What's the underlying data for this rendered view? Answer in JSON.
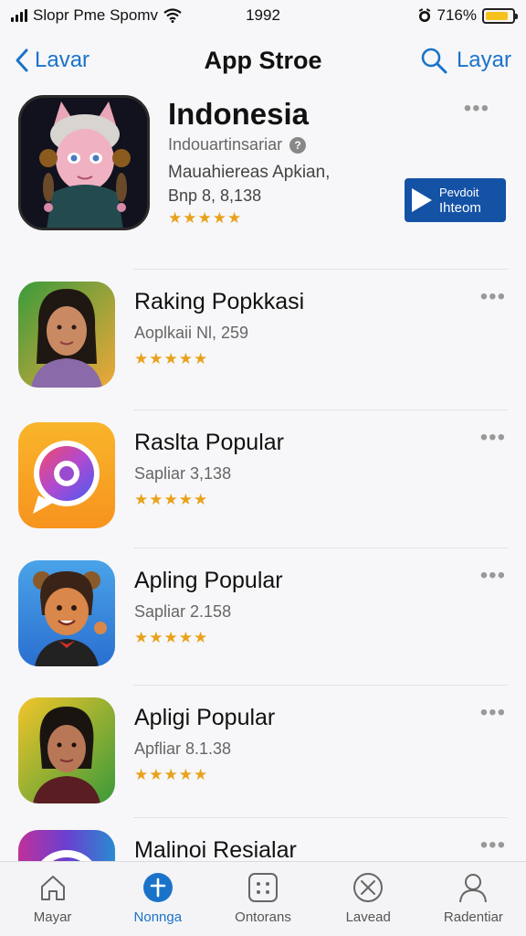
{
  "status_bar": {
    "carrier": "Slopr Pme Spomv",
    "time": "1992",
    "battery": "716%",
    "battery_level": 0.85,
    "battery_color": "#f4c21b"
  },
  "nav": {
    "back_label": "Lavar",
    "title": "App Stroe",
    "search_label": "Layar",
    "accent_color": "#1a73c9"
  },
  "featured": {
    "title": "Indonesia",
    "subtitle": "Indouartinsariar",
    "description": "Mauahiereas Apkian,",
    "count": "Bnp 8, 8,138",
    "rating": 4.5,
    "get_button": {
      "line1": "Pevdoit",
      "line2": "Ihteom",
      "color": "#1452a6"
    }
  },
  "apps": [
    {
      "name": "Raking Popkkasi",
      "meta": "Aoplkaii Nl, 259",
      "rating": 4.5,
      "icon": "avatar-woman-icon"
    },
    {
      "name": "Raslta Popular",
      "meta": "Sapliar 3,138",
      "rating": 4.5,
      "icon": "chat-bubble-icon"
    },
    {
      "name": "Apling Popular",
      "meta": "Sapliar 2.158",
      "rating": 4.5,
      "icon": "avatar-bear-icon"
    },
    {
      "name": "Apligi Popular",
      "meta": "Apfliar 8.1.38",
      "rating": 4.5,
      "icon": "avatar-woman-icon"
    },
    {
      "name": "Malinoi Resialar",
      "meta": "",
      "rating": 0,
      "icon": "gradient-app-icon"
    }
  ],
  "tabs": [
    {
      "label": "Mayar",
      "icon": "home-icon",
      "active": false
    },
    {
      "label": "Nonnga",
      "icon": "plus-circle-icon",
      "active": true
    },
    {
      "label": "Ontorans",
      "icon": "grid-icon",
      "active": false
    },
    {
      "label": "Lavead",
      "icon": "close-circle-icon",
      "active": false
    },
    {
      "label": "Radentiar",
      "icon": "person-icon",
      "active": false
    }
  ]
}
